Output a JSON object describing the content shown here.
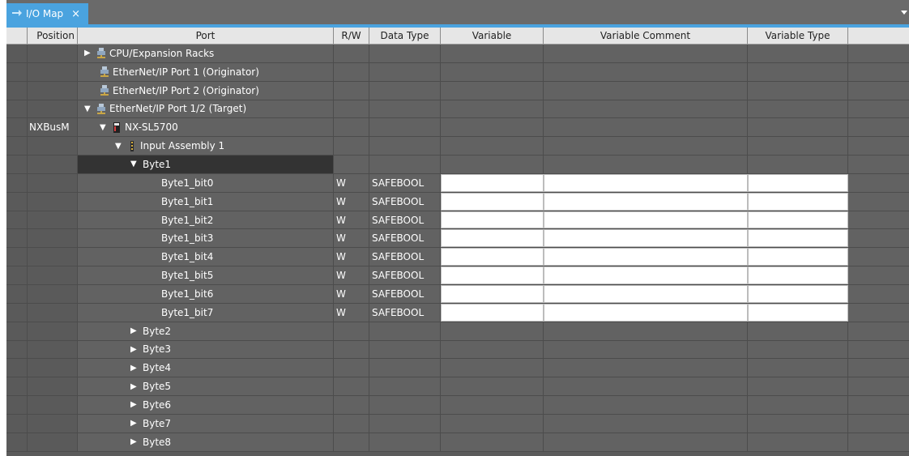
{
  "tab": {
    "title": "I/O Map",
    "close": "×"
  },
  "columns": {
    "position": "Position",
    "port": "Port",
    "rw": "R/W",
    "data_type": "Data Type",
    "variable": "Variable",
    "variable_comment": "Variable Comment",
    "variable_type": "Variable Type"
  },
  "rows": [
    {
      "position": "",
      "port": "CPU/Expansion Racks",
      "indent": 1,
      "expander": "▶",
      "icon": "port-icon",
      "rw": "",
      "type": "",
      "editable": false
    },
    {
      "position": "",
      "port": "EtherNet/IP Port 1 (Originator)",
      "indent": 2,
      "expander": "",
      "icon": "port-icon",
      "rw": "",
      "type": "",
      "editable": false
    },
    {
      "position": "",
      "port": "EtherNet/IP Port 2 (Originator)",
      "indent": 2,
      "expander": "",
      "icon": "port-icon",
      "rw": "",
      "type": "",
      "editable": false
    },
    {
      "position": "",
      "port": "EtherNet/IP Port 1/2 (Target)",
      "indent": 1,
      "expander": "▼",
      "icon": "port-icon",
      "rw": "",
      "type": "",
      "editable": false
    },
    {
      "position": "NXBusM",
      "port": "NX-SL5700",
      "indent": 2,
      "expander": "▼",
      "icon": "unit-icon",
      "rw": "",
      "type": "",
      "editable": false
    },
    {
      "position": "",
      "port": "Input Assembly 1",
      "indent": 3,
      "expander": "▼",
      "icon": "assembly-icon",
      "rw": "",
      "type": "",
      "editable": false
    },
    {
      "position": "",
      "port": "Byte1",
      "indent": 4,
      "expander": "▼",
      "icon": "",
      "rw": "",
      "type": "",
      "editable": false,
      "selected": true
    },
    {
      "position": "",
      "port": "Byte1_bit0",
      "indent": 6,
      "expander": "",
      "icon": "",
      "rw": "W",
      "type": "SAFEBOOL",
      "editable": true
    },
    {
      "position": "",
      "port": "Byte1_bit1",
      "indent": 6,
      "expander": "",
      "icon": "",
      "rw": "W",
      "type": "SAFEBOOL",
      "editable": true
    },
    {
      "position": "",
      "port": "Byte1_bit2",
      "indent": 6,
      "expander": "",
      "icon": "",
      "rw": "W",
      "type": "SAFEBOOL",
      "editable": true
    },
    {
      "position": "",
      "port": "Byte1_bit3",
      "indent": 6,
      "expander": "",
      "icon": "",
      "rw": "W",
      "type": "SAFEBOOL",
      "editable": true
    },
    {
      "position": "",
      "port": "Byte1_bit4",
      "indent": 6,
      "expander": "",
      "icon": "",
      "rw": "W",
      "type": "SAFEBOOL",
      "editable": true
    },
    {
      "position": "",
      "port": "Byte1_bit5",
      "indent": 6,
      "expander": "",
      "icon": "",
      "rw": "W",
      "type": "SAFEBOOL",
      "editable": true
    },
    {
      "position": "",
      "port": "Byte1_bit6",
      "indent": 6,
      "expander": "",
      "icon": "",
      "rw": "W",
      "type": "SAFEBOOL",
      "editable": true
    },
    {
      "position": "",
      "port": "Byte1_bit7",
      "indent": 6,
      "expander": "",
      "icon": "",
      "rw": "W",
      "type": "SAFEBOOL",
      "editable": true
    },
    {
      "position": "",
      "port": "Byte2",
      "indent": 4,
      "expander": "▶",
      "icon": "",
      "rw": "",
      "type": "",
      "editable": false
    },
    {
      "position": "",
      "port": "Byte3",
      "indent": 4,
      "expander": "▶",
      "icon": "",
      "rw": "",
      "type": "",
      "editable": false
    },
    {
      "position": "",
      "port": "Byte4",
      "indent": 4,
      "expander": "▶",
      "icon": "",
      "rw": "",
      "type": "",
      "editable": false
    },
    {
      "position": "",
      "port": "Byte5",
      "indent": 4,
      "expander": "▶",
      "icon": "",
      "rw": "",
      "type": "",
      "editable": false
    },
    {
      "position": "",
      "port": "Byte6",
      "indent": 4,
      "expander": "▶",
      "icon": "",
      "rw": "",
      "type": "",
      "editable": false
    },
    {
      "position": "",
      "port": "Byte7",
      "indent": 4,
      "expander": "▶",
      "icon": "",
      "rw": "",
      "type": "",
      "editable": false
    },
    {
      "position": "",
      "port": "Byte8",
      "indent": 4,
      "expander": "▶",
      "icon": "",
      "rw": "",
      "type": "",
      "editable": false
    }
  ],
  "colors": {
    "accent": "#4aa3df",
    "grid_bg": "#626262",
    "header_bg": "#e6e6e6",
    "selected_row": "#333333"
  }
}
